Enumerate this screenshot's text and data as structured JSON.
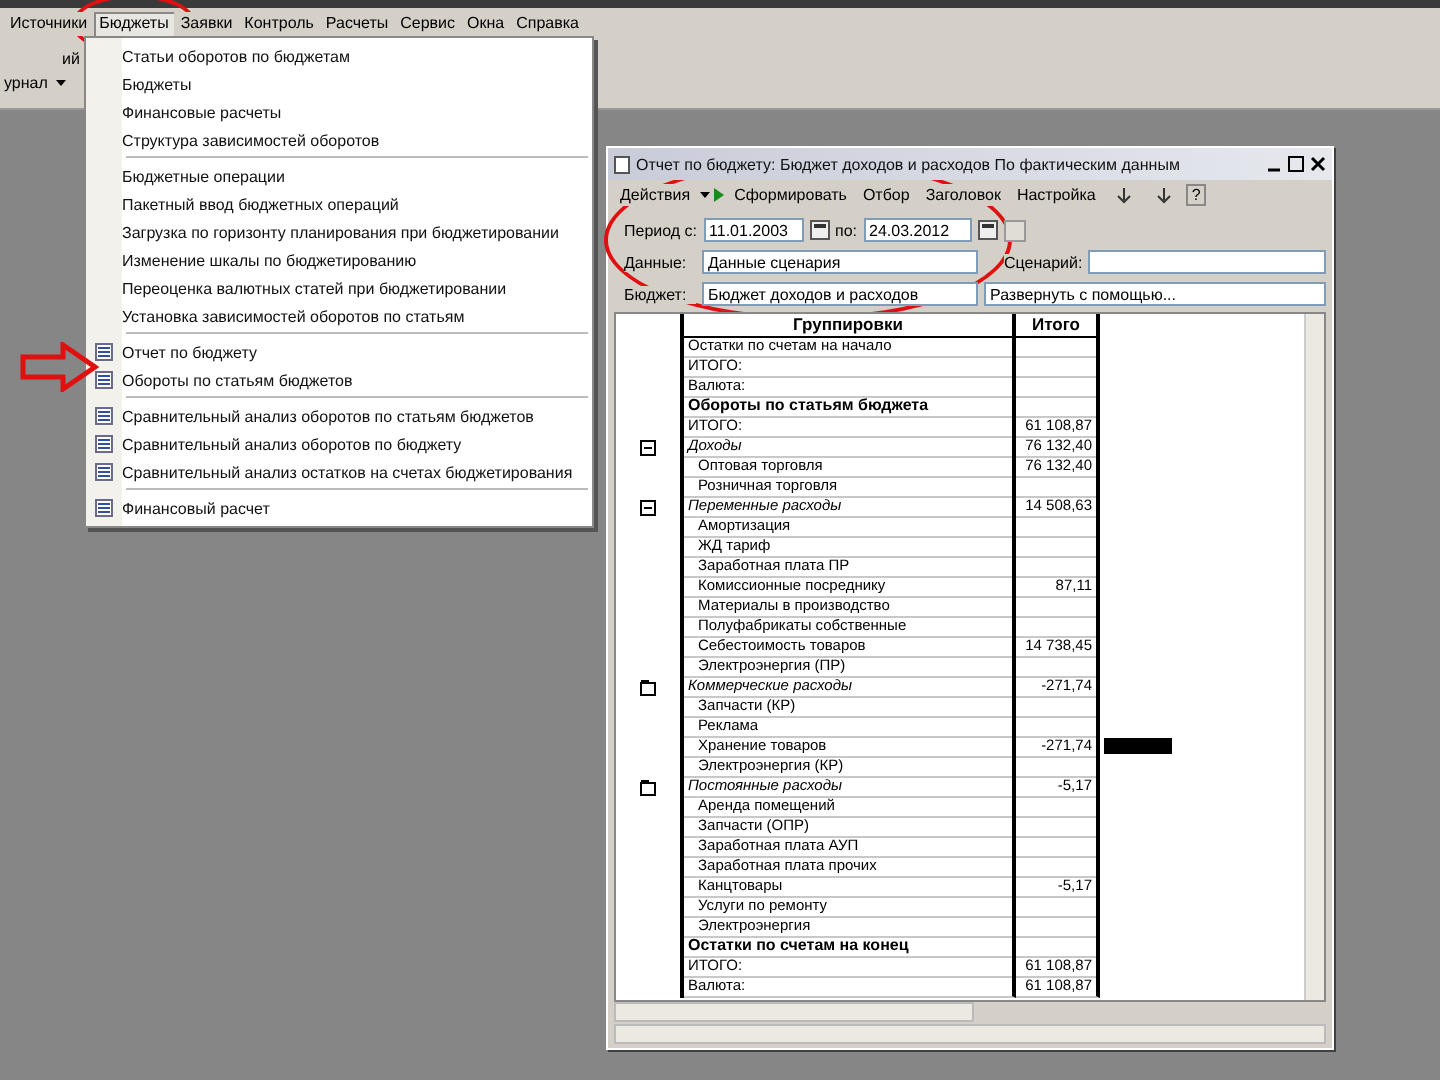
{
  "menu_bar": {
    "items": [
      {
        "label": "Источники",
        "selected": false
      },
      {
        "label": "Бюджеты",
        "selected": true
      },
      {
        "label": "Заявки",
        "selected": false
      },
      {
        "label": "Контроль",
        "selected": false
      },
      {
        "label": "Расчеты",
        "selected": false
      },
      {
        "label": "Сервис",
        "selected": false
      },
      {
        "label": "Окна",
        "selected": false
      },
      {
        "label": "Справка",
        "selected": false
      }
    ]
  },
  "toolbar": {
    "button_label": "ий",
    "combo_value": "урнал"
  },
  "dropdown": {
    "items": [
      {
        "kind": "item",
        "label": "Статьи оборотов по бюджетам",
        "icon": false
      },
      {
        "kind": "item",
        "label": "Бюджеты",
        "icon": false
      },
      {
        "kind": "item",
        "label": "Финансовые расчеты",
        "icon": false
      },
      {
        "kind": "item",
        "label": "Структура зависимостей оборотов",
        "icon": false
      },
      {
        "kind": "separator"
      },
      {
        "kind": "item",
        "label": "Бюджетные операции",
        "icon": false
      },
      {
        "kind": "item",
        "label": "Пакетный ввод бюджетных операций",
        "icon": false
      },
      {
        "kind": "item",
        "label": "Загрузка по горизонту планирования при бюджетировании",
        "icon": false
      },
      {
        "kind": "item",
        "label": "Изменение шкалы по бюджетированию",
        "icon": false
      },
      {
        "kind": "item",
        "label": "Переоценка валютных статей при бюджетировании",
        "icon": false
      },
      {
        "kind": "item",
        "label": "Установка зависимостей оборотов по статьям",
        "icon": false
      },
      {
        "kind": "separator"
      },
      {
        "kind": "item",
        "label": "Отчет по бюджету",
        "icon": true
      },
      {
        "kind": "item",
        "label": "Обороты по статьям бюджетов",
        "icon": true
      },
      {
        "kind": "separator"
      },
      {
        "kind": "item",
        "label": "Сравнительный анализ оборотов по статьям бюджетов",
        "icon": true
      },
      {
        "kind": "item",
        "label": "Сравнительный анализ оборотов по бюджету",
        "icon": true
      },
      {
        "kind": "item",
        "label": "Сравнительный анализ остатков на счетах бюджетирования",
        "icon": true
      },
      {
        "kind": "separator"
      },
      {
        "kind": "item",
        "label": "Финансовый расчет",
        "icon": true
      }
    ]
  },
  "report": {
    "title": "Отчет по бюджету: Бюджет доходов и расходов По фактическим данным",
    "toolbar": [
      {
        "kind": "menu",
        "label": "Действия"
      },
      {
        "kind": "run",
        "label": "Сформировать"
      },
      {
        "kind": "text",
        "label": "Отбор"
      },
      {
        "kind": "text",
        "label": "Заголовок"
      },
      {
        "kind": "text",
        "label": "Настройка"
      },
      {
        "kind": "icon"
      },
      {
        "kind": "icon"
      },
      {
        "kind": "help",
        "label": "?"
      }
    ],
    "period_label": "Период с:",
    "period_from": "11.01.2003",
    "period_to_label": "по:",
    "period_to": "24.03.2012",
    "data_label": "Данные:",
    "data_value": "Данные сценария",
    "scenario_label": "Сценарий:",
    "budget_label": "Бюджет:",
    "budget_value": "Бюджет доходов и расходов",
    "expand_value": "Развернуть с помощью...",
    "columns": [
      "Группировки",
      "Итого"
    ],
    "rows": [
      {
        "kind": "item",
        "label": "Остатки по счетам на начало",
        "total": ""
      },
      {
        "kind": "item",
        "label": "ИТОГО:",
        "total": ""
      },
      {
        "kind": "item",
        "label": "Валюта:",
        "total": ""
      },
      {
        "kind": "section",
        "label": "Обороты по статьям бюджета",
        "total": ""
      },
      {
        "kind": "item",
        "label": "ИТОГО:",
        "total": "61 108,87"
      },
      {
        "kind": "group",
        "label": "Доходы",
        "total": "76 132,40",
        "expanded": true
      },
      {
        "kind": "sub",
        "label": "Оптовая торговля",
        "total": "76 132,40"
      },
      {
        "kind": "sub",
        "label": "Розничная торговля",
        "total": ""
      },
      {
        "kind": "group",
        "label": "Переменные расходы",
        "total": "14 508,63",
        "expanded": true
      },
      {
        "kind": "sub",
        "label": "Амортизация",
        "total": ""
      },
      {
        "kind": "sub",
        "label": "ЖД тариф",
        "total": ""
      },
      {
        "kind": "sub",
        "label": "Заработная плата ПР",
        "total": ""
      },
      {
        "kind": "sub",
        "label": "Комиссионные посреднику",
        "total": "87,11"
      },
      {
        "kind": "sub",
        "label": "Материалы в производство",
        "total": ""
      },
      {
        "kind": "sub",
        "label": "Полуфабрикаты собственные",
        "total": ""
      },
      {
        "kind": "sub",
        "label": "Себестоимость товаров",
        "total": "14 738,45"
      },
      {
        "kind": "sub",
        "label": "Электроэнергия (ПР)",
        "total": ""
      },
      {
        "kind": "group",
        "label": "Коммерческие расходы",
        "total": "-271,74",
        "expanded": false
      },
      {
        "kind": "sub",
        "label": "Запчасти (КР)",
        "total": ""
      },
      {
        "kind": "sub",
        "label": "Реклама",
        "total": ""
      },
      {
        "kind": "sub",
        "label": "Хранение товаров",
        "total": "-271,74",
        "marked": true
      },
      {
        "kind": "sub",
        "label": "Электроэнергия (КР)",
        "total": ""
      },
      {
        "kind": "group",
        "label": "Постоянные расходы",
        "total": "-5,17",
        "expanded": false
      },
      {
        "kind": "sub",
        "label": "Аренда помещений",
        "total": ""
      },
      {
        "kind": "sub",
        "label": "Запчасти (ОПР)",
        "total": ""
      },
      {
        "kind": "sub",
        "label": "Заработная плата АУП",
        "total": ""
      },
      {
        "kind": "sub",
        "label": "Заработная плата прочих",
        "total": ""
      },
      {
        "kind": "sub",
        "label": "Канцтовары",
        "total": "-5,17"
      },
      {
        "kind": "sub",
        "label": "Услуги по ремонту",
        "total": ""
      },
      {
        "kind": "sub",
        "label": "Электроэнергия",
        "total": ""
      },
      {
        "kind": "section",
        "label": "Остатки по счетам на конец",
        "total": ""
      },
      {
        "kind": "item",
        "label": "ИТОГО:",
        "total": "61 108,87"
      },
      {
        "kind": "item",
        "label": "Валюта:",
        "total": "61 108,87"
      }
    ]
  }
}
